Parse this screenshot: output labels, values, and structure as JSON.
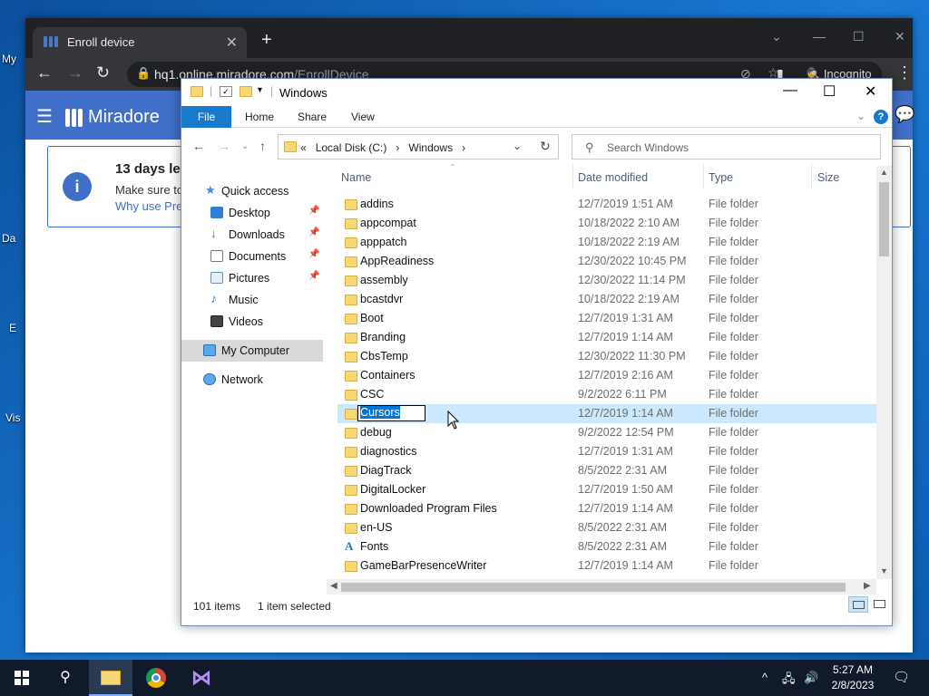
{
  "desktop": {
    "labels": [
      "My",
      "Da",
      "E",
      "Vis"
    ]
  },
  "browser": {
    "tab_title": "Enroll device",
    "new_tab": "+",
    "url_host": "hq1.online.miradore.com",
    "url_path": "/EnrollDevice",
    "profile_label": "Incognito"
  },
  "miradore": {
    "logo_text": "Miradore",
    "notice_title": "13 days lef",
    "notice_text": "Make sure to",
    "notice_link": "Why use Pre"
  },
  "explorer": {
    "title": "Windows",
    "ribbon_tabs": [
      "File",
      "Home",
      "Share",
      "View"
    ],
    "address_crumbs": [
      "«",
      "Local Disk (C:)",
      "›",
      "Windows",
      "›"
    ],
    "search_placeholder": "Search Windows",
    "nav_pane": [
      {
        "label": "Quick access",
        "icon": "star-icon",
        "pinned": false
      },
      {
        "label": "Desktop",
        "icon": "desktop-icon",
        "pinned": true
      },
      {
        "label": "Downloads",
        "icon": "download-icon",
        "pinned": true
      },
      {
        "label": "Documents",
        "icon": "documents-icon",
        "pinned": true
      },
      {
        "label": "Pictures",
        "icon": "pictures-icon",
        "pinned": true
      },
      {
        "label": "Music",
        "icon": "music-icon",
        "pinned": false
      },
      {
        "label": "Videos",
        "icon": "videos-icon",
        "pinned": false
      },
      {
        "label": "My Computer",
        "icon": "computer-icon",
        "pinned": false
      },
      {
        "label": "Network",
        "icon": "network-icon",
        "pinned": false
      }
    ],
    "columns": [
      "Name",
      "Date modified",
      "Type",
      "Size"
    ],
    "files": [
      {
        "name": "addins",
        "date": "12/7/2019 1:51 AM",
        "type": "File folder"
      },
      {
        "name": "appcompat",
        "date": "10/18/2022 2:10 AM",
        "type": "File folder"
      },
      {
        "name": "apppatch",
        "date": "10/18/2022 2:19 AM",
        "type": "File folder"
      },
      {
        "name": "AppReadiness",
        "date": "12/30/2022 10:45 PM",
        "type": "File folder"
      },
      {
        "name": "assembly",
        "date": "12/30/2022 11:14 PM",
        "type": "File folder"
      },
      {
        "name": "bcastdvr",
        "date": "10/18/2022 2:19 AM",
        "type": "File folder"
      },
      {
        "name": "Boot",
        "date": "12/7/2019 1:31 AM",
        "type": "File folder"
      },
      {
        "name": "Branding",
        "date": "12/7/2019 1:14 AM",
        "type": "File folder"
      },
      {
        "name": "CbsTemp",
        "date": "12/30/2022 11:30 PM",
        "type": "File folder"
      },
      {
        "name": "Containers",
        "date": "12/7/2019 2:16 AM",
        "type": "File folder"
      },
      {
        "name": "CSC",
        "date": "9/2/2022 6:11 PM",
        "type": "File folder"
      },
      {
        "name": "Cursors",
        "date": "12/7/2019 1:14 AM",
        "type": "File folder",
        "selected": true,
        "renaming": true
      },
      {
        "name": "debug",
        "date": "9/2/2022 12:54 PM",
        "type": "File folder"
      },
      {
        "name": "diagnostics",
        "date": "12/7/2019 1:31 AM",
        "type": "File folder"
      },
      {
        "name": "DiagTrack",
        "date": "8/5/2022 2:31 AM",
        "type": "File folder"
      },
      {
        "name": "DigitalLocker",
        "date": "12/7/2019 1:50 AM",
        "type": "File folder"
      },
      {
        "name": "Downloaded Program Files",
        "date": "12/7/2019 1:14 AM",
        "type": "File folder"
      },
      {
        "name": "en-US",
        "date": "8/5/2022 2:31 AM",
        "type": "File folder"
      },
      {
        "name": "Fonts",
        "date": "8/5/2022 2:31 AM",
        "type": "File folder",
        "icon": "fonts-folder-icon"
      },
      {
        "name": "GameBarPresenceWriter",
        "date": "12/7/2019 1:14 AM",
        "type": "File folder"
      }
    ],
    "status_items": "101 items",
    "status_selected": "1 item selected"
  },
  "taskbar": {
    "time": "5:27 AM",
    "date": "2/8/2023"
  },
  "colors": {
    "accent": "#1979ca",
    "selection": "#cce8ff",
    "miradore": "#3f6fc9",
    "folder": "#f8d775"
  }
}
